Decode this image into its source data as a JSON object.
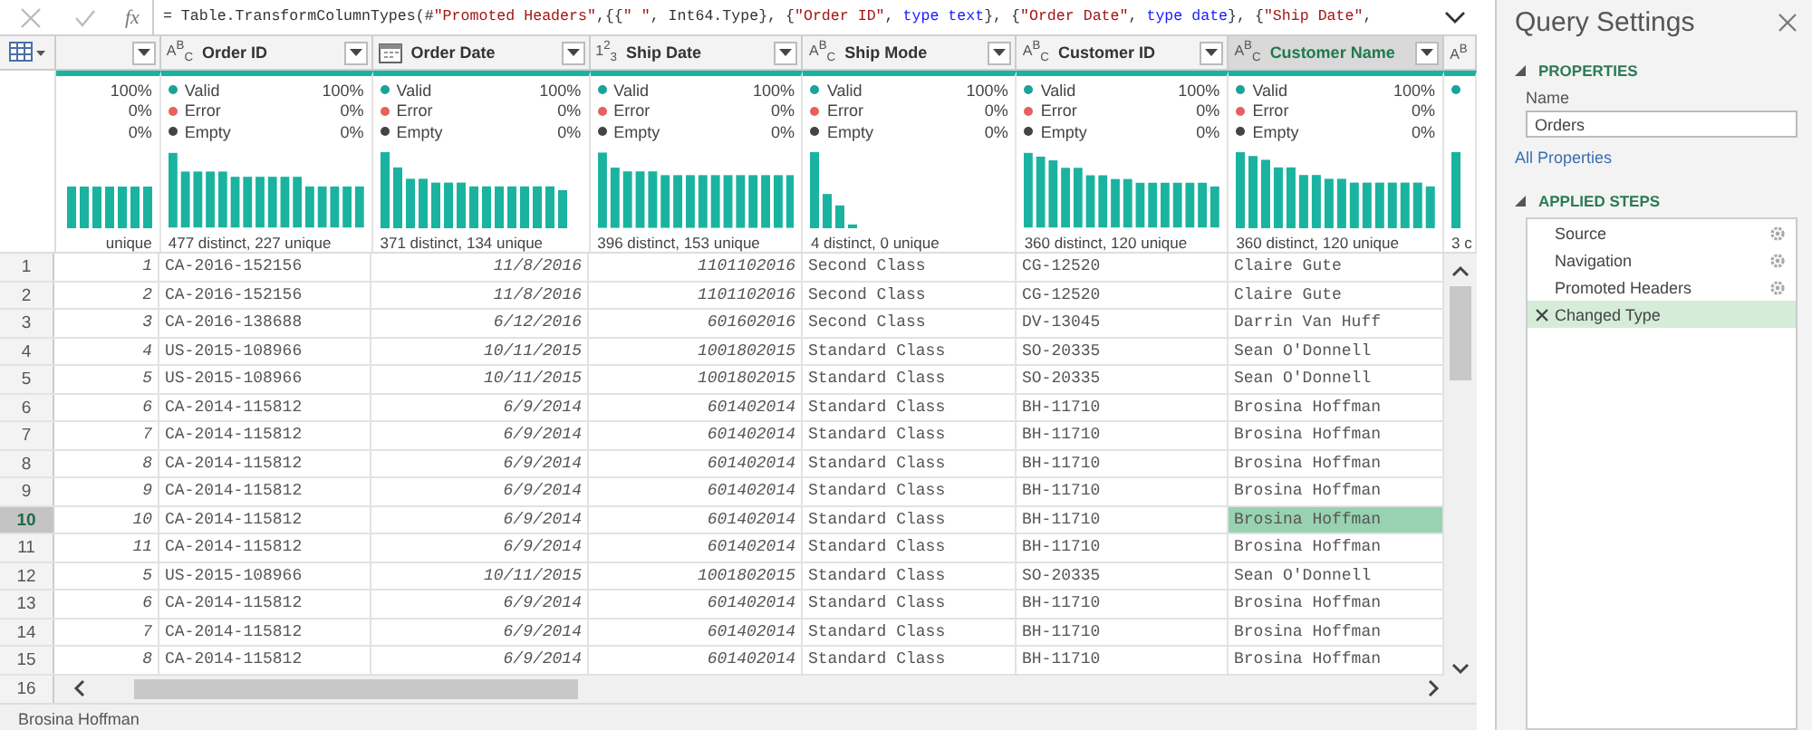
{
  "formula_bar": {
    "fx": "fx",
    "tokens": [
      {
        "kind": "plain",
        "text": "= Table.TransformColumnTypes(#"
      },
      {
        "kind": "string",
        "text": "\"Promoted Headers\""
      },
      {
        "kind": "plain",
        "text": ",{{"
      },
      {
        "kind": "string",
        "text": "\" \""
      },
      {
        "kind": "plain",
        "text": ", Int64.Type}, {"
      },
      {
        "kind": "string",
        "text": "\"Order ID\""
      },
      {
        "kind": "plain",
        "text": ", "
      },
      {
        "kind": "keyword",
        "text": "type text"
      },
      {
        "kind": "plain",
        "text": "}, {"
      },
      {
        "kind": "string",
        "text": "\"Order Date\""
      },
      {
        "kind": "plain",
        "text": ", "
      },
      {
        "kind": "keyword",
        "text": "type date"
      },
      {
        "kind": "plain",
        "text": "}, {"
      },
      {
        "kind": "string",
        "text": "\"Ship Date\""
      },
      {
        "kind": "plain",
        "text": ","
      }
    ]
  },
  "columns": [
    {
      "kind": "number",
      "selected": false,
      "quality": [
        {
          "value": "100%"
        },
        {
          "value": "0%"
        },
        {
          "value": "0%"
        }
      ],
      "stats": "unique"
    },
    {
      "kind": "text",
      "type_label": "A$^{B}$$_{C}$",
      "label": "Order ID",
      "selected": false,
      "quality": [
        {
          "label": "Valid",
          "value": "100%",
          "color": "#1aa39a"
        },
        {
          "label": "Error",
          "value": "0%",
          "color": "#e8605c"
        },
        {
          "label": "Empty",
          "value": "0%",
          "color": "#444444"
        }
      ],
      "stats": "477 distinct, 227 unique"
    },
    {
      "kind": "date",
      "label": "Order Date",
      "selected": false,
      "quality": [
        {
          "label": "Valid",
          "value": "100%",
          "color": "#1aa39a"
        },
        {
          "label": "Error",
          "value": "0%",
          "color": "#e8605c"
        },
        {
          "label": "Empty",
          "value": "0%",
          "color": "#444444"
        }
      ],
      "stats": "371 distinct, 134 unique"
    },
    {
      "kind": "number",
      "type_label": "1$^{2}$$_{3}$",
      "label": "Ship Date",
      "selected": false,
      "quality": [
        {
          "label": "Valid",
          "value": "100%",
          "color": "#1aa39a"
        },
        {
          "label": "Error",
          "value": "0%",
          "color": "#e8605c"
        },
        {
          "label": "Empty",
          "value": "0%",
          "color": "#444444"
        }
      ],
      "stats": "396 distinct, 153 unique"
    },
    {
      "kind": "text",
      "type_label": "A$^{B}$$_{C}$",
      "label": "Ship Mode",
      "selected": false,
      "quality": [
        {
          "label": "Valid",
          "value": "100%",
          "color": "#1aa39a"
        },
        {
          "label": "Error",
          "value": "0%",
          "color": "#e8605c"
        },
        {
          "label": "Empty",
          "value": "0%",
          "color": "#444444"
        }
      ],
      "stats": "4 distinct, 0 unique"
    },
    {
      "kind": "text",
      "type_label": "A$^{B}$$_{C}$",
      "label": "Customer ID",
      "selected": false,
      "quality": [
        {
          "label": "Valid",
          "value": "100%",
          "color": "#1aa39a"
        },
        {
          "label": "Error",
          "value": "0%",
          "color": "#e8605c"
        },
        {
          "label": "Empty",
          "value": "0%",
          "color": "#444444"
        }
      ],
      "stats": "360 distinct, 120 unique"
    },
    {
      "kind": "text",
      "type_label": "A$^{B}$$_{C}$",
      "label": "Customer Name",
      "selected": true,
      "quality": [
        {
          "label": "Valid",
          "value": "100%",
          "color": "#1aa39a"
        },
        {
          "label": "Error",
          "value": "0%",
          "color": "#e8605c"
        },
        {
          "label": "Empty",
          "value": "0%",
          "color": "#444444"
        }
      ],
      "stats": "360 distinct, 120 unique"
    },
    {
      "kind": "text",
      "type_label": "A$^{B}$",
      "selected": false,
      "quality": [
        {
          "color": "#1aa39a"
        }
      ],
      "stats": "3 c"
    }
  ],
  "rows": [
    {
      "number": "1",
      "selected": false,
      "cells": [
        "1",
        "CA-2016-152156",
        "11/8/2016",
        "1101102016",
        "Second Class",
        "CG-12520",
        "Claire Gute"
      ]
    },
    {
      "number": "2",
      "selected": false,
      "cells": [
        "2",
        "CA-2016-152156",
        "11/8/2016",
        "1101102016",
        "Second Class",
        "CG-12520",
        "Claire Gute"
      ]
    },
    {
      "number": "3",
      "selected": false,
      "cells": [
        "3",
        "CA-2016-138688",
        "6/12/2016",
        "601602016",
        "Second Class",
        "DV-13045",
        "Darrin Van Huff"
      ]
    },
    {
      "number": "4",
      "selected": false,
      "cells": [
        "4",
        "US-2015-108966",
        "10/11/2015",
        "1001802015",
        "Standard Class",
        "SO-20335",
        "Sean O'Donnell"
      ]
    },
    {
      "number": "5",
      "selected": false,
      "cells": [
        "5",
        "US-2015-108966",
        "10/11/2015",
        "1001802015",
        "Standard Class",
        "SO-20335",
        "Sean O'Donnell"
      ]
    },
    {
      "number": "6",
      "selected": false,
      "cells": [
        "6",
        "CA-2014-115812",
        "6/9/2014",
        "601402014",
        "Standard Class",
        "BH-11710",
        "Brosina Hoffman"
      ]
    },
    {
      "number": "7",
      "selected": false,
      "cells": [
        "7",
        "CA-2014-115812",
        "6/9/2014",
        "601402014",
        "Standard Class",
        "BH-11710",
        "Brosina Hoffman"
      ]
    },
    {
      "number": "8",
      "selected": false,
      "cells": [
        "8",
        "CA-2014-115812",
        "6/9/2014",
        "601402014",
        "Standard Class",
        "BH-11710",
        "Brosina Hoffman"
      ]
    },
    {
      "number": "9",
      "selected": false,
      "cells": [
        "9",
        "CA-2014-115812",
        "6/9/2014",
        "601402014",
        "Standard Class",
        "BH-11710",
        "Brosina Hoffman"
      ]
    },
    {
      "number": "10",
      "selected": true,
      "cells": [
        "10",
        "CA-2014-115812",
        "6/9/2014",
        "601402014",
        "Standard Class",
        "BH-11710",
        "Brosina Hoffman"
      ]
    },
    {
      "number": "11",
      "selected": false,
      "cells": [
        "11",
        "CA-2014-115812",
        "6/9/2014",
        "601402014",
        "Standard Class",
        "BH-11710",
        "Brosina Hoffman"
      ]
    },
    {
      "number": "12",
      "selected": false,
      "cells": [
        "5",
        "US-2015-108966",
        "10/11/2015",
        "1001802015",
        "Standard Class",
        "SO-20335",
        "Sean O'Donnell"
      ]
    },
    {
      "number": "13",
      "selected": false,
      "cells": [
        "6",
        "CA-2014-115812",
        "6/9/2014",
        "601402014",
        "Standard Class",
        "BH-11710",
        "Brosina Hoffman"
      ]
    },
    {
      "number": "14",
      "selected": false,
      "cells": [
        "7",
        "CA-2014-115812",
        "6/9/2014",
        "601402014",
        "Standard Class",
        "BH-11710",
        "Brosina Hoffman"
      ]
    },
    {
      "number": "15",
      "selected": false,
      "cells": [
        "8",
        "CA-2014-115812",
        "6/9/2014",
        "601402014",
        "Standard Class",
        "BH-11710",
        "Brosina Hoffman"
      ]
    },
    {
      "number": "16",
      "selected": false,
      "cells": []
    }
  ],
  "status_bar": {
    "text": "Brosina Hoffman"
  },
  "query_settings": {
    "title": "Query Settings",
    "properties": {
      "heading": "PROPERTIES",
      "expanded": true,
      "name_label": "Name",
      "name_value": "Orders",
      "link": "All Properties"
    },
    "applied_steps": {
      "heading": "APPLIED STEPS",
      "expanded": true,
      "steps": [
        {
          "label": "Source",
          "selected": false,
          "has_settings": true
        },
        {
          "label": "Navigation",
          "selected": false,
          "has_settings": true
        },
        {
          "label": "Promoted Headers",
          "selected": false,
          "has_settings": true
        },
        {
          "label": "Changed Type",
          "selected": true,
          "has_settings": false
        }
      ]
    }
  }
}
